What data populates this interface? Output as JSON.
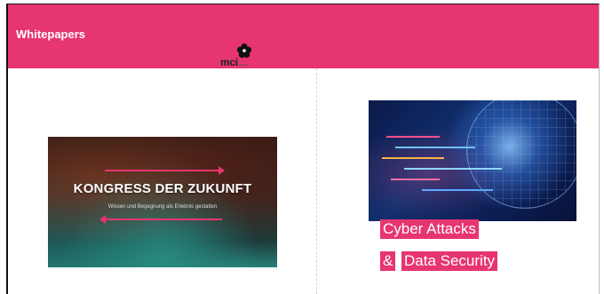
{
  "header": {
    "title": "Whitepapers"
  },
  "cards": [
    {
      "brand": {
        "name": "mci",
        "tagline": "group"
      },
      "image_title": "KONGRESS DER ZUKUNFT",
      "image_subtitle": "Wissen und Begegnung als Erlebnis gestalten"
    },
    {
      "tag_line1": "Cyber Attacks",
      "tag_line2_prefix": "&",
      "tag_line2": "Data Security"
    }
  ],
  "colors": {
    "accent": "#e7356f",
    "header_text": "#ffffff"
  }
}
